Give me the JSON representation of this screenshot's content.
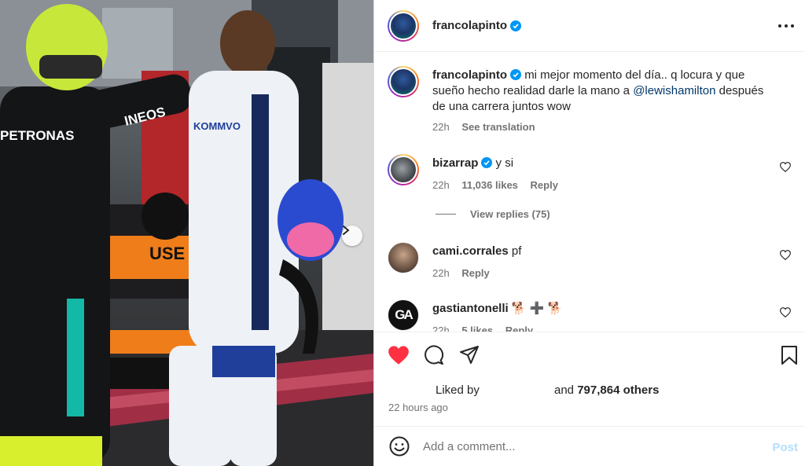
{
  "post": {
    "author": "francolapinto",
    "more_icon": "more-horizontal-icon"
  },
  "comments": [
    {
      "username": "francolapinto",
      "verified": true,
      "text_before": "mi mejor momento del día.. q locura y que sueño hecho realidad darle la mano a ",
      "mention": "@lewishamilton",
      "text_after": " después de una carrera juntos wow",
      "time": "22h",
      "translate": "See translation"
    },
    {
      "username": "bizarrap",
      "verified": true,
      "text": "y si",
      "time": "22h",
      "likes": "11,036 likes",
      "reply": "Reply",
      "view_replies": "View replies (75)"
    },
    {
      "username": "cami.corrales",
      "verified": false,
      "text": "pf",
      "time": "22h",
      "reply": "Reply"
    },
    {
      "username": "gastiantonelli",
      "verified": false,
      "text": "🐕 ➕ 🐕",
      "avatar_text": "GA",
      "time": "22h",
      "likes": "5 likes",
      "reply": "Reply"
    }
  ],
  "actions": {
    "liked_by_prefix": "Liked by",
    "liked_by_count": "797,864 others",
    "liked_by_and": "and",
    "time_ago": "22 hours ago"
  },
  "add_comment": {
    "placeholder": "Add a comment...",
    "post_label": "Post"
  },
  "colors": {
    "like_red": "#ff3040",
    "mention_blue": "#00376b",
    "verified_blue": "#0095f6",
    "post_disabled": "#b2dffc"
  }
}
